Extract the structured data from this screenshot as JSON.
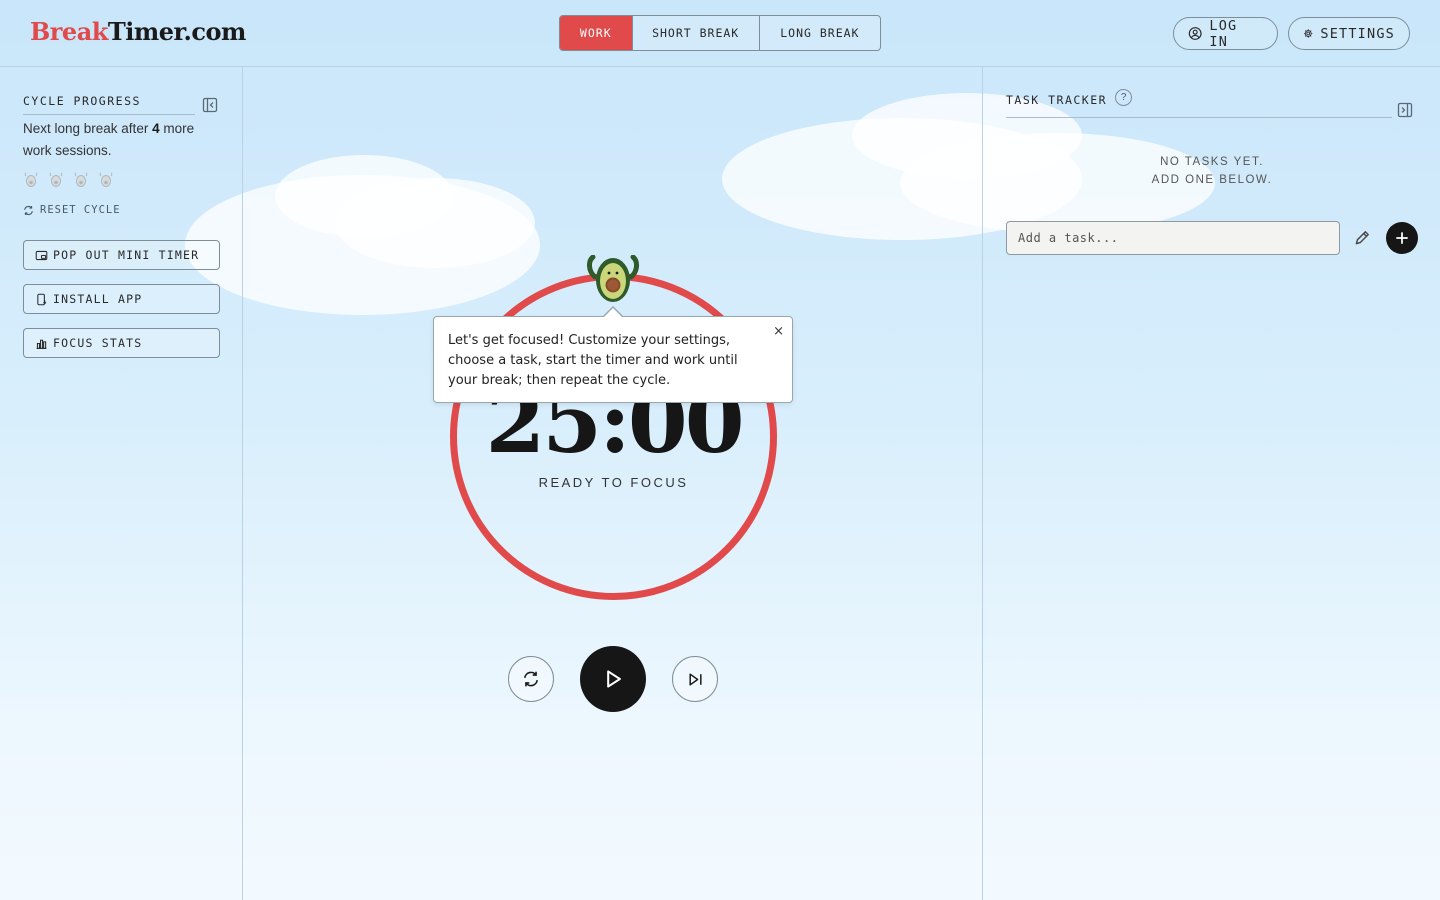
{
  "brand": {
    "accent_part": "Break",
    "rest_part": "Timer.com",
    "accent_color": "#e04a4a"
  },
  "mode_tabs": [
    {
      "label": "WORK",
      "active": true
    },
    {
      "label": "SHORT BREAK",
      "active": false
    },
    {
      "label": "LONG BREAK",
      "active": false
    }
  ],
  "header": {
    "login_label": "LOG IN",
    "login_icon": "user-circle-icon",
    "settings_label": "SETTINGS",
    "settings_icon": "gear-icon"
  },
  "cycle_progress": {
    "title": "CYCLE PROGRESS",
    "text_before": "Next long break after ",
    "count": "4",
    "text_after": " more work sessions.",
    "sessions_completed": 0,
    "sessions_total": 4,
    "reset_label": "RESET CYCLE"
  },
  "side_buttons": {
    "mini_timer": "POP OUT MINI TIMER",
    "install": "INSTALL APP",
    "stats": "FOCUS STATS"
  },
  "timer": {
    "time": "25:00",
    "status": "READY TO FOCUS",
    "ring_color": "#e04a4a",
    "progress_fraction": 1.0
  },
  "tooltip": {
    "text": "Let's get focused! Customize your settings, choose a task, start the timer and work until your break; then repeat the cycle.",
    "close": "×"
  },
  "task_tracker": {
    "title": "TASK TRACKER",
    "help": "?",
    "empty_line1": "NO TASKS YET.",
    "empty_line2": "ADD ONE BELOW.",
    "input_placeholder": "Add a task...",
    "add_icon": "plus-icon",
    "edit_icon": "pencil-icon"
  },
  "controls": {
    "reset_icon": "refresh-icon",
    "play_icon": "play-icon",
    "skip_icon": "skip-forward-icon"
  }
}
